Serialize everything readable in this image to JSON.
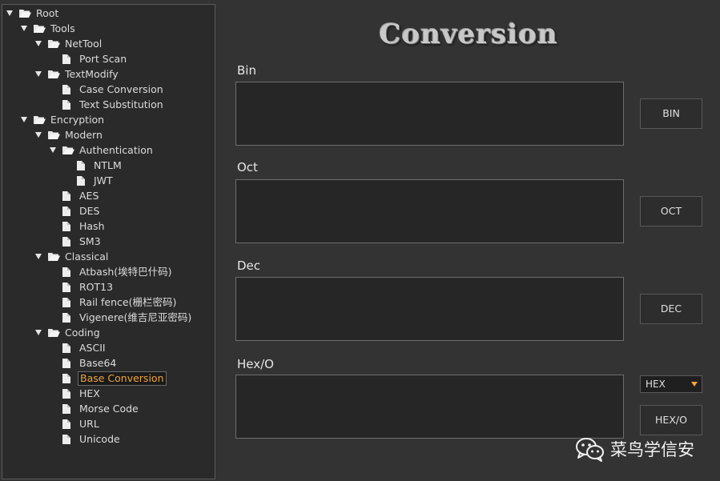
{
  "tree": [
    {
      "label": "Root",
      "depth": 0,
      "kind": "folder",
      "expanded": true
    },
    {
      "label": "Tools",
      "depth": 1,
      "kind": "folder",
      "expanded": true
    },
    {
      "label": "NetTool",
      "depth": 2,
      "kind": "folder",
      "expanded": true
    },
    {
      "label": "Port Scan",
      "depth": 3,
      "kind": "file"
    },
    {
      "label": "TextModify",
      "depth": 2,
      "kind": "folder",
      "expanded": true
    },
    {
      "label": "Case Conversion",
      "depth": 3,
      "kind": "file"
    },
    {
      "label": "Text Substitution",
      "depth": 3,
      "kind": "file"
    },
    {
      "label": "Encryption",
      "depth": 1,
      "kind": "folder",
      "expanded": true
    },
    {
      "label": "Modern",
      "depth": 2,
      "kind": "folder",
      "expanded": true
    },
    {
      "label": "Authentication",
      "depth": 3,
      "kind": "folder",
      "expanded": true
    },
    {
      "label": "NTLM",
      "depth": 4,
      "kind": "file"
    },
    {
      "label": "JWT",
      "depth": 4,
      "kind": "file"
    },
    {
      "label": "AES",
      "depth": 3,
      "kind": "file"
    },
    {
      "label": "DES",
      "depth": 3,
      "kind": "file"
    },
    {
      "label": "Hash",
      "depth": 3,
      "kind": "file"
    },
    {
      "label": "SM3",
      "depth": 3,
      "kind": "file"
    },
    {
      "label": "Classical",
      "depth": 2,
      "kind": "folder",
      "expanded": true
    },
    {
      "label": "Atbash(埃特巴什码)",
      "depth": 3,
      "kind": "file"
    },
    {
      "label": "ROT13",
      "depth": 3,
      "kind": "file"
    },
    {
      "label": "Rail fence(栅栏密码)",
      "depth": 3,
      "kind": "file"
    },
    {
      "label": "Vigenere(维吉尼亚密码)",
      "depth": 3,
      "kind": "file"
    },
    {
      "label": "Coding",
      "depth": 2,
      "kind": "folder",
      "expanded": true
    },
    {
      "label": "ASCII",
      "depth": 3,
      "kind": "file"
    },
    {
      "label": "Base64",
      "depth": 3,
      "kind": "file"
    },
    {
      "label": "Base Conversion",
      "depth": 3,
      "kind": "file",
      "selected": true
    },
    {
      "label": "HEX",
      "depth": 3,
      "kind": "file"
    },
    {
      "label": "Morse Code",
      "depth": 3,
      "kind": "file"
    },
    {
      "label": "URL",
      "depth": 3,
      "kind": "file"
    },
    {
      "label": "Unicode",
      "depth": 3,
      "kind": "file"
    }
  ],
  "panel": {
    "title": "Conversion",
    "bin": {
      "label": "Bin",
      "value": "",
      "button": "BIN"
    },
    "oct": {
      "label": "Oct",
      "value": "",
      "button": "OCT"
    },
    "dec": {
      "label": "Dec",
      "value": "",
      "button": "DEC"
    },
    "hex": {
      "label": "Hex/O",
      "value": "",
      "button": "HEX/O",
      "mode_selected": "HEX"
    }
  },
  "watermark": {
    "text": "菜鸟学信安",
    "icon": "wechat-icon"
  },
  "colors": {
    "background": "#333333",
    "tree_background": "#2a2a2a",
    "selected_text": "#f0a43a",
    "text": "#dcdcdc"
  }
}
